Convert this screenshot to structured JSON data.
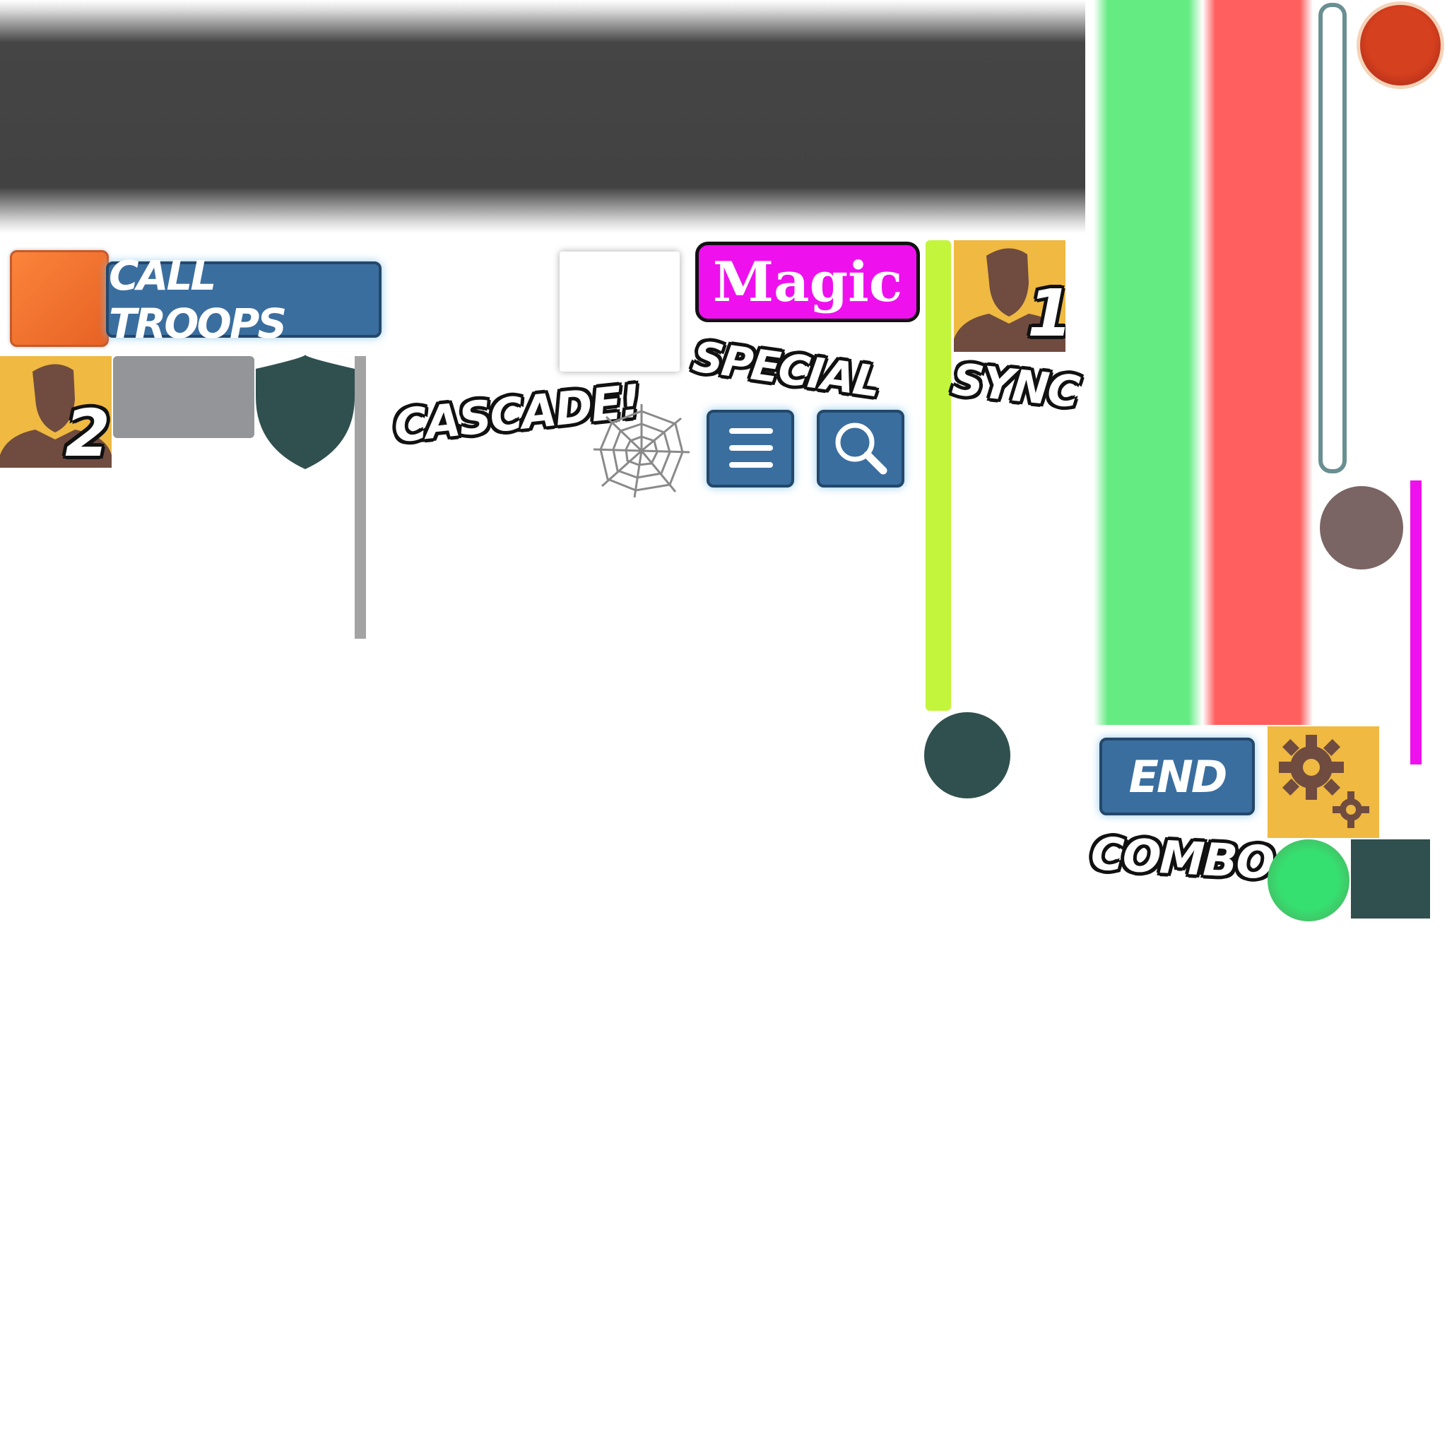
{
  "buttons": {
    "call_troops": "CALL TROOPS",
    "magic": "Magic",
    "end": "END"
  },
  "labels": {
    "special": "SPECIAL",
    "sync": "SYNC",
    "cascade": "CASCADE!",
    "combo": "COMBO"
  },
  "avatars": [
    {
      "number": "1"
    },
    {
      "number": "2"
    }
  ],
  "icons": {
    "menu": "menu-icon",
    "search": "search-icon",
    "gear": "gear-icon",
    "shield": "shield-icon",
    "web": "spider-web-icon",
    "person": "person-icon"
  },
  "colors": {
    "button_blue": "#3a6e9f",
    "magic_magenta": "#ee11ee",
    "avatar_yellow": "#efb942",
    "dark_teal": "#2f504e",
    "green_bar": "#64eb82",
    "red_bar": "#ff5f5f",
    "lime_bar": "#c3f53c"
  }
}
